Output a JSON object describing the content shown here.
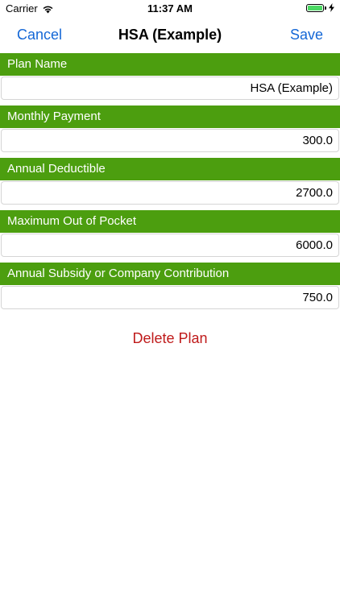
{
  "status_bar": {
    "carrier": "Carrier",
    "time": "11:37 AM",
    "battery_level": 1.0
  },
  "nav": {
    "cancel": "Cancel",
    "title": "HSA (Example)",
    "save": "Save"
  },
  "fields": [
    {
      "label": "Plan Name",
      "value": "HSA (Example)"
    },
    {
      "label": "Monthly Payment",
      "value": "300.0"
    },
    {
      "label": "Annual Deductible",
      "value": "2700.0"
    },
    {
      "label": "Maximum Out of Pocket",
      "value": "6000.0"
    },
    {
      "label": "Annual Subsidy or Company Contribution",
      "value": "750.0"
    }
  ],
  "delete_label": "Delete Plan",
  "colors": {
    "section_header": "#4c9e0f",
    "nav_link": "#1467d6",
    "delete": "#bf1a1a",
    "battery": "#4cd964"
  }
}
